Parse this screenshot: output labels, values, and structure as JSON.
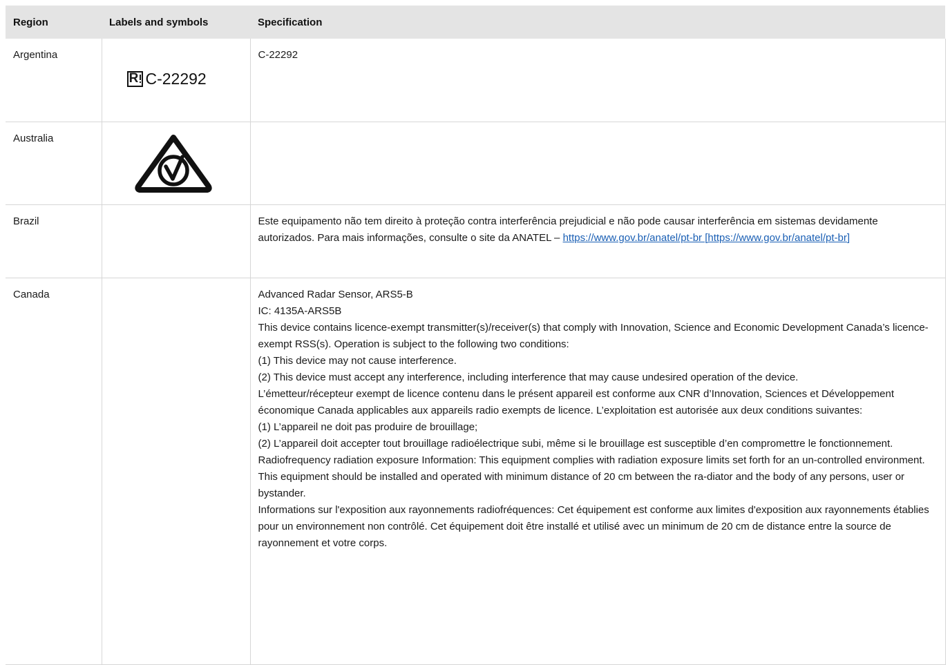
{
  "table": {
    "headers": {
      "region": "Region",
      "labels": "Labels and symbols",
      "spec": "Specification"
    },
    "rows": {
      "argentina": {
        "region": "Argentina",
        "symbol_text": "C-22292",
        "symbol_icon": "r-box-icon",
        "spec": "C-22292"
      },
      "australia": {
        "region": "Australia",
        "symbol_icon": "rcm-compliance-triangle-icon",
        "spec": ""
      },
      "brazil": {
        "region": "Brazil",
        "spec_text": "Este equipamento não tem direito à proteção contra interferência prejudicial e não pode causar interferência em sistemas devidamente autorizados. Para mais informações, consulte o site da ANATEL – ",
        "spec_link": "https://www.gov.br/anatel/pt-br [https://www.gov.br/anatel/pt-br]"
      },
      "canada": {
        "region": "Canada",
        "lines": [
          "Advanced Radar Sensor, ARS5-B",
          "IC: 4135A-ARS5B",
          "This device contains licence-exempt transmitter(s)/receiver(s) that comply with Innovation, Science and Economic Development Canada’s licence-exempt RSS(s). Operation is subject to the following two conditions:",
          "(1) This device may not cause interference.",
          "(2) This device must accept any interference, including interference that may cause undesired operation of the device.",
          "L’émetteur/récepteur exempt de licence contenu dans le présent appareil est conforme aux CNR d’Innovation, Sciences et Développement économique Canada applicables aux appareils radio exempts de licence. L’exploitation est autorisée aux deux conditions suivantes:",
          "(1) L’appareil ne doit pas produire de brouillage;",
          "(2) L’appareil doit accepter tout brouillage radioélectrique subi, même si le brouillage est susceptible d’en compromettre le fonctionnement.",
          "Radiofrequency radiation exposure Information: This equipment complies with radiation exposure limits set forth for an un-controlled environment. This equipment should be installed and operated with minimum distance of 20 cm between the ra-diator and the body of any persons, user or bystander.",
          "Informations sur l'exposition aux rayonnements radiofréquences: Cet équipement est conforme aux limites d'exposition aux rayonnements établies pour un environnement non contrôlé. Cet équipement doit être installé et utilisé avec un minimum de 20 cm de distance entre la source de rayonnement et votre corps."
        ]
      }
    }
  },
  "colors": {
    "header_bg": "#e4e4e4",
    "border": "#d6d6d6",
    "link": "#1a5fb4"
  }
}
